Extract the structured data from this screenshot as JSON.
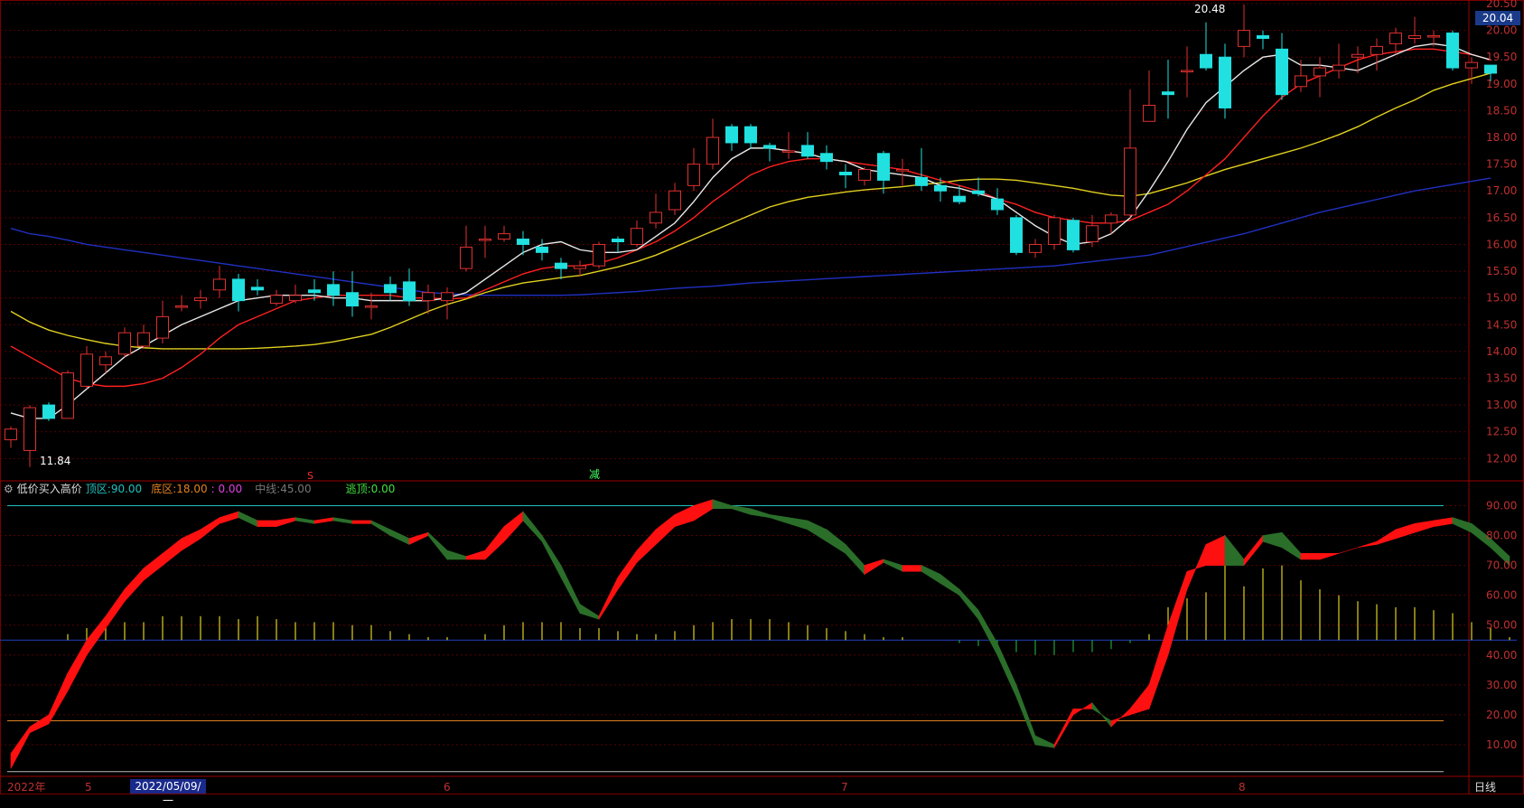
{
  "price_panel": {
    "yticks": [
      "20.50",
      "20.00",
      "19.50",
      "19.00",
      "18.50",
      "18.00",
      "17.50",
      "17.00",
      "16.50",
      "16.00",
      "15.50",
      "15.00",
      "14.50",
      "14.00",
      "13.50",
      "13.00",
      "12.50",
      "12.00"
    ],
    "current_price": "20.04",
    "high_label": "20.48",
    "low_label": "11.84",
    "signal_s": "S",
    "signal_reduce": "减"
  },
  "indicator": {
    "name": "低价买入高价",
    "top_zone_label": "顶区:",
    "top_zone_value": "90.00",
    "bottom_zone_label": "底区:",
    "bottom_zone_value": "18.00",
    "extra_value": ": 0.00",
    "mid_label": "中线:",
    "mid_value": "45.00",
    "escape_label": "逃顶:",
    "escape_value": "0.00",
    "yticks": [
      "90.00",
      "80.00",
      "70.00",
      "60.00",
      "50.00",
      "40.00",
      "30.00",
      "20.00",
      "10.00"
    ]
  },
  "xaxis": {
    "year": "2022年",
    "m5": "5",
    "highlight_date": "2022/05/09/一",
    "m6": "6",
    "m7": "7",
    "m8": "8",
    "period": "日线"
  },
  "colors": {
    "bg": "#000000",
    "grid": "#5a0000",
    "up": "#e03030",
    "down": "#20e0e0",
    "ma5": "#e8e8e8",
    "ma10": "#ff2020",
    "ma20": "#e0d020",
    "ma60": "#2030c0",
    "top_line": "#20c0c0",
    "bottom_line": "#e08020"
  },
  "chart_data": [
    {
      "type": "candlestick",
      "title": "",
      "ylim": [
        11.6,
        20.5
      ],
      "candles": [
        [
          12.35,
          12.55,
          12.6,
          12.2
        ],
        [
          12.15,
          12.95,
          13.0,
          11.84
        ],
        [
          13.0,
          12.75,
          13.05,
          12.7
        ],
        [
          12.75,
          13.6,
          13.65,
          12.75
        ],
        [
          13.35,
          13.95,
          14.1,
          13.3
        ],
        [
          13.75,
          13.9,
          14.0,
          13.6
        ],
        [
          13.95,
          14.35,
          14.45,
          13.9
        ],
        [
          14.1,
          14.35,
          14.5,
          14.05
        ],
        [
          14.25,
          14.65,
          14.95,
          14.15
        ],
        [
          14.85,
          14.85,
          15.05,
          14.75
        ],
        [
          14.95,
          15.0,
          15.15,
          14.8
        ],
        [
          15.15,
          15.35,
          15.6,
          15.0
        ],
        [
          15.35,
          14.95,
          15.45,
          14.75
        ],
        [
          15.2,
          15.15,
          15.35,
          15.05
        ],
        [
          14.9,
          15.05,
          15.15,
          14.85
        ],
        [
          14.95,
          15.05,
          15.25,
          14.9
        ],
        [
          15.15,
          15.1,
          15.35,
          14.95
        ],
        [
          15.25,
          15.05,
          15.5,
          14.85
        ],
        [
          15.1,
          14.85,
          15.5,
          14.65
        ],
        [
          14.85,
          14.85,
          15.1,
          14.6
        ],
        [
          15.25,
          15.1,
          15.4,
          14.95
        ],
        [
          15.3,
          14.95,
          15.55,
          14.85
        ],
        [
          14.95,
          15.1,
          15.25,
          14.7
        ],
        [
          14.95,
          15.1,
          15.2,
          14.6
        ],
        [
          15.55,
          15.95,
          16.35,
          15.5
        ],
        [
          16.1,
          16.1,
          16.35,
          15.75
        ],
        [
          16.1,
          16.2,
          16.35,
          16.05
        ],
        [
          16.1,
          16.0,
          16.25,
          15.8
        ],
        [
          15.95,
          15.85,
          16.1,
          15.7
        ],
        [
          15.65,
          15.55,
          15.75,
          15.35
        ],
        [
          15.55,
          15.6,
          15.7,
          15.4
        ],
        [
          15.6,
          16.0,
          16.05,
          15.55
        ],
        [
          16.1,
          16.05,
          16.15,
          15.85
        ],
        [
          16.0,
          16.3,
          16.45,
          15.95
        ],
        [
          16.4,
          16.6,
          16.95,
          16.3
        ],
        [
          16.65,
          17.0,
          17.15,
          16.55
        ],
        [
          17.1,
          17.5,
          17.8,
          17.0
        ],
        [
          17.5,
          18.0,
          18.35,
          17.4
        ],
        [
          18.2,
          17.9,
          18.25,
          17.75
        ],
        [
          18.2,
          17.9,
          18.25,
          17.8
        ],
        [
          17.85,
          17.8,
          17.9,
          17.55
        ],
        [
          17.75,
          17.75,
          18.1,
          17.6
        ],
        [
          17.85,
          17.65,
          18.1,
          17.6
        ],
        [
          17.7,
          17.55,
          17.85,
          17.4
        ],
        [
          17.35,
          17.3,
          17.5,
          17.05
        ],
        [
          17.2,
          17.4,
          17.45,
          17.1
        ],
        [
          17.7,
          17.2,
          17.75,
          16.95
        ],
        [
          17.4,
          17.4,
          17.6,
          17.1
        ],
        [
          17.25,
          17.1,
          17.8,
          17.0
        ],
        [
          17.1,
          17.0,
          17.25,
          16.8
        ],
        [
          16.9,
          16.8,
          17.1,
          16.75
        ],
        [
          17.0,
          16.95,
          17.25,
          16.9
        ],
        [
          16.85,
          16.65,
          17.05,
          16.55
        ],
        [
          16.5,
          15.85,
          16.55,
          15.8
        ],
        [
          15.85,
          16.0,
          16.1,
          15.75
        ],
        [
          16.0,
          16.5,
          16.55,
          15.9
        ],
        [
          16.45,
          15.9,
          16.5,
          15.85
        ],
        [
          16.05,
          16.35,
          16.55,
          15.95
        ],
        [
          16.4,
          16.55,
          16.6,
          16.2
        ],
        [
          16.55,
          17.8,
          18.9,
          16.5
        ],
        [
          18.3,
          18.6,
          19.25,
          18.3
        ],
        [
          18.85,
          18.8,
          19.45,
          18.35
        ],
        [
          19.25,
          19.25,
          19.7,
          18.75
        ],
        [
          19.55,
          19.3,
          20.15,
          19.25
        ],
        [
          19.5,
          18.55,
          19.75,
          18.35
        ],
        [
          19.7,
          20.0,
          20.48,
          19.5
        ],
        [
          19.9,
          19.85,
          20.0,
          19.65
        ],
        [
          19.65,
          18.8,
          19.95,
          18.7
        ],
        [
          18.95,
          19.15,
          19.45,
          18.85
        ],
        [
          19.15,
          19.3,
          19.5,
          18.75
        ],
        [
          19.25,
          19.35,
          19.75,
          19.1
        ],
        [
          19.5,
          19.55,
          19.7,
          19.2
        ],
        [
          19.55,
          19.7,
          19.85,
          19.25
        ],
        [
          19.75,
          19.95,
          20.05,
          19.55
        ],
        [
          19.85,
          19.9,
          20.25,
          19.75
        ],
        [
          19.9,
          19.9,
          20.0,
          19.7
        ],
        [
          19.95,
          19.3,
          20.0,
          19.25
        ],
        [
          19.3,
          19.4,
          19.5,
          19.0
        ],
        [
          19.35,
          19.2,
          19.35,
          19.05
        ]
      ],
      "ma5": [
        12.85,
        12.75,
        12.75,
        13.0,
        13.3,
        13.6,
        13.9,
        14.1,
        14.3,
        14.5,
        14.65,
        14.8,
        14.95,
        15.0,
        15.05,
        15.05,
        15.05,
        15.0,
        15.0,
        14.95,
        14.95,
        14.95,
        14.95,
        15.0,
        15.1,
        15.35,
        15.6,
        15.85,
        16.0,
        16.05,
        15.9,
        15.85,
        15.85,
        15.9,
        16.15,
        16.4,
        16.8,
        17.25,
        17.6,
        17.8,
        17.8,
        17.75,
        17.7,
        17.6,
        17.55,
        17.4,
        17.35,
        17.3,
        17.25,
        17.1,
        17.05,
        16.95,
        16.85,
        16.6,
        16.35,
        16.15,
        16.0,
        16.05,
        16.2,
        16.5,
        17.0,
        17.55,
        18.15,
        18.65,
        18.95,
        19.25,
        19.5,
        19.55,
        19.35,
        19.35,
        19.3,
        19.25,
        19.4,
        19.55,
        19.7,
        19.75,
        19.7,
        19.55,
        19.45
      ],
      "ma10": [
        14.1,
        13.9,
        13.7,
        13.5,
        13.4,
        13.35,
        13.35,
        13.4,
        13.5,
        13.7,
        13.95,
        14.25,
        14.5,
        14.65,
        14.8,
        14.95,
        15.0,
        15.05,
        15.05,
        15.05,
        15.05,
        15.0,
        15.0,
        14.98,
        15.0,
        15.15,
        15.3,
        15.45,
        15.55,
        15.6,
        15.6,
        15.65,
        15.75,
        15.9,
        16.05,
        16.25,
        16.5,
        16.8,
        17.05,
        17.3,
        17.45,
        17.55,
        17.6,
        17.6,
        17.55,
        17.5,
        17.45,
        17.4,
        17.3,
        17.2,
        17.1,
        17.0,
        16.85,
        16.75,
        16.6,
        16.5,
        16.45,
        16.4,
        16.4,
        16.45,
        16.6,
        16.75,
        17.0,
        17.3,
        17.6,
        18.0,
        18.4,
        18.75,
        19.0,
        19.15,
        19.3,
        19.45,
        19.55,
        19.6,
        19.65,
        19.65,
        19.6,
        19.55,
        19.45
      ],
      "ma20": [
        14.75,
        14.55,
        14.4,
        14.3,
        14.22,
        14.15,
        14.1,
        14.07,
        14.05,
        14.05,
        14.05,
        14.05,
        14.05,
        14.06,
        14.08,
        14.1,
        14.13,
        14.18,
        14.25,
        14.32,
        14.45,
        14.6,
        14.75,
        14.88,
        14.98,
        15.1,
        15.2,
        15.28,
        15.33,
        15.38,
        15.42,
        15.5,
        15.58,
        15.68,
        15.8,
        15.95,
        16.1,
        16.25,
        16.4,
        16.55,
        16.7,
        16.8,
        16.88,
        16.93,
        16.98,
        17.02,
        17.05,
        17.08,
        17.12,
        17.15,
        17.2,
        17.22,
        17.22,
        17.2,
        17.15,
        17.1,
        17.05,
        16.98,
        16.92,
        16.9,
        16.95,
        17.05,
        17.15,
        17.28,
        17.4,
        17.5,
        17.6,
        17.7,
        17.8,
        17.92,
        18.05,
        18.2,
        18.38,
        18.55,
        18.7,
        18.88,
        19.0,
        19.1,
        19.2
      ],
      "ma60": [
        16.3,
        16.2,
        16.15,
        16.08,
        16.0,
        15.95,
        15.9,
        15.85,
        15.8,
        15.75,
        15.7,
        15.65,
        15.6,
        15.55,
        15.5,
        15.45,
        15.4,
        15.35,
        15.3,
        15.25,
        15.2,
        15.15,
        15.1,
        15.08,
        15.06,
        15.05,
        15.05,
        15.05,
        15.05,
        15.05,
        15.06,
        15.08,
        15.1,
        15.12,
        15.15,
        15.18,
        15.2,
        15.22,
        15.25,
        15.28,
        15.3,
        15.32,
        15.34,
        15.36,
        15.38,
        15.4,
        15.42,
        15.44,
        15.46,
        15.48,
        15.5,
        15.52,
        15.54,
        15.56,
        15.58,
        15.6,
        15.64,
        15.68,
        15.72,
        15.76,
        15.8,
        15.88,
        15.96,
        16.04,
        16.12,
        16.2,
        16.3,
        16.4,
        16.5,
        16.6,
        16.68,
        16.76,
        16.84,
        16.92,
        17.0,
        17.06,
        17.12,
        17.18,
        17.24
      ]
    },
    {
      "type": "area",
      "title": "低价买入高价",
      "ylim": [
        0,
        98
      ],
      "series": [
        {
          "name": "",
          "values": [
            7,
            16,
            20,
            34,
            45,
            53,
            62,
            69,
            74,
            79,
            82,
            86,
            88,
            85,
            85,
            86,
            85,
            86,
            85,
            85,
            82,
            79,
            81,
            75,
            73,
            75,
            83,
            88,
            80,
            70,
            57,
            53,
            66,
            75,
            82,
            87,
            90,
            92,
            90,
            89,
            87,
            86,
            85,
            82,
            77,
            70,
            72,
            70,
            70,
            67,
            62,
            55,
            44,
            30,
            13,
            10,
            22,
            22,
            18,
            20,
            22,
            40,
            62,
            77,
            80,
            72,
            80,
            81,
            74,
            74,
            74,
            76,
            78,
            82,
            84,
            85,
            86,
            84,
            79,
            73
          ]
        },
        {
          "name": "",
          "values": [
            2,
            14,
            17,
            28,
            40,
            49,
            58,
            65,
            70,
            75,
            79,
            84,
            86,
            83,
            83,
            85,
            84,
            85,
            84,
            84,
            80,
            77,
            80,
            72,
            72,
            72,
            78,
            85,
            78,
            66,
            54,
            52,
            62,
            71,
            77,
            83,
            85,
            89,
            89,
            87,
            86,
            84,
            82,
            78,
            74,
            67,
            71,
            68,
            68,
            64,
            60,
            52,
            40,
            26,
            10,
            9,
            20,
            24,
            16,
            22,
            30,
            50,
            68,
            70,
            70,
            70,
            78,
            76,
            72,
            72,
            74,
            76,
            77,
            79,
            81,
            83,
            84,
            81,
            76,
            70
          ]
        }
      ],
      "bars": [
        0,
        0,
        0,
        2,
        4,
        5,
        6,
        6,
        8,
        8,
        8,
        8,
        7,
        8,
        7,
        6,
        6,
        6,
        5,
        5,
        3,
        2,
        1,
        1,
        0,
        2,
        5,
        6,
        6,
        6,
        4,
        4,
        3,
        2,
        2,
        3,
        5,
        6,
        7,
        7,
        7,
        6,
        5,
        4,
        3,
        2,
        1,
        1,
        0,
        0,
        -1,
        -2,
        -3,
        -4,
        -5,
        -5,
        -4,
        -4,
        -3,
        -1,
        2,
        11,
        14,
        16,
        25,
        18,
        24,
        25,
        20,
        17,
        15,
        13,
        12,
        11,
        11,
        10,
        9,
        6,
        4,
        1
      ],
      "reference_lines": {
        "top": 90,
        "bottom": 18,
        "mid": 45
      }
    }
  ]
}
